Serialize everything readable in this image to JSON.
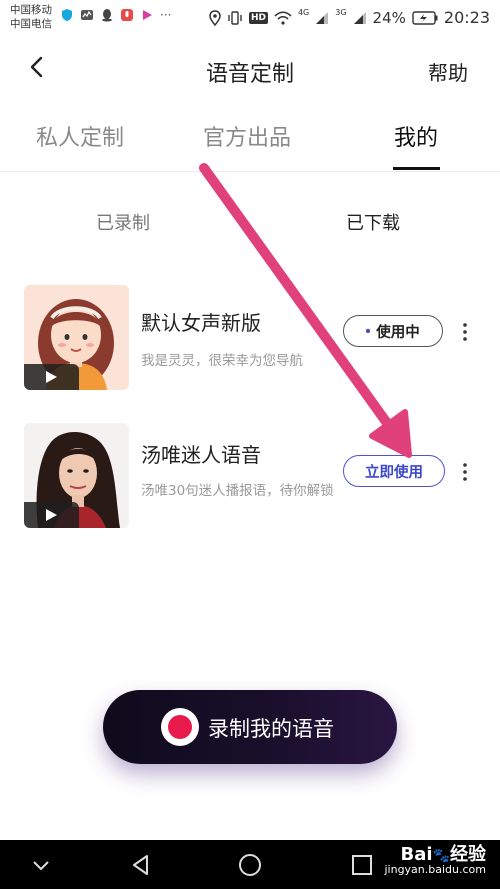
{
  "status_bar": {
    "carrier_1": "中国移动",
    "carrier_2": "中国电信",
    "network_1": "4G",
    "network_2": "3G",
    "hd": "HD",
    "battery": "24%",
    "time": "20:23",
    "more": "···"
  },
  "header": {
    "title": "语音定制",
    "help": "帮助"
  },
  "tabs": [
    {
      "label": "私人定制"
    },
    {
      "label": "官方出品"
    },
    {
      "label": "我的"
    }
  ],
  "active_tab": "我的",
  "sub_tabs": [
    {
      "label": "已录制"
    },
    {
      "label": "已下载"
    }
  ],
  "voices": [
    {
      "name": "默认女声新版",
      "desc": "我是灵灵，很荣幸为您导航",
      "action": "使用中"
    },
    {
      "name": "汤唯迷人语音",
      "desc": "汤唯30句迷人播报语，待你解锁",
      "action": "立即使用"
    }
  ],
  "record": {
    "label": "录制我的语音"
  },
  "watermark": {
    "brand": "Bai",
    "brand_2": "经验",
    "site": "jingyan.baidu.com"
  },
  "colors": {
    "accent": "#3d47c8",
    "record_red": "#e8194b",
    "arrow": "#e0417a"
  }
}
